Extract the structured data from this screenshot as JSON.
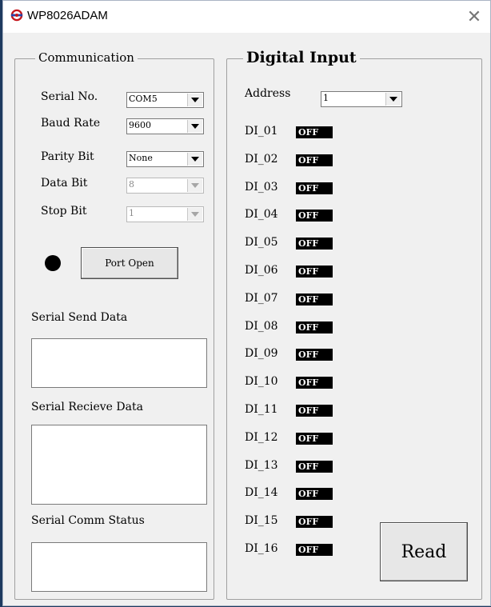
{
  "window": {
    "title": "WP8026ADAM",
    "close_glyph": "✕"
  },
  "communication": {
    "legend": "Communication",
    "serial_no": {
      "label": "Serial No.",
      "value": "COM5"
    },
    "baud_rate": {
      "label": "Baud Rate",
      "value": "9600"
    },
    "parity_bit": {
      "label": "Parity Bit",
      "value": "None"
    },
    "data_bit": {
      "label": "Data Bit",
      "value": "8"
    },
    "stop_bit": {
      "label": "Stop Bit",
      "value": "1"
    },
    "port_button": "Port Open",
    "led_color": "#000000",
    "send_label": "Serial Send Data",
    "send_value": "",
    "recv_label": "Serial Recieve Data",
    "recv_value": "",
    "status_label": "Serial Comm Status",
    "status_value": ""
  },
  "digital_input": {
    "legend": "Digital Input",
    "address_label": "Address",
    "address_value": "1",
    "channels": [
      {
        "label": "DI_01",
        "state": "OFF"
      },
      {
        "label": "DI_02",
        "state": "OFF"
      },
      {
        "label": "DI_03",
        "state": "OFF"
      },
      {
        "label": "DI_04",
        "state": "OFF"
      },
      {
        "label": "DI_05",
        "state": "OFF"
      },
      {
        "label": "DI_06",
        "state": "OFF"
      },
      {
        "label": "DI_07",
        "state": "OFF"
      },
      {
        "label": "DI_08",
        "state": "OFF"
      },
      {
        "label": "DI_09",
        "state": "OFF"
      },
      {
        "label": "DI_10",
        "state": "OFF"
      },
      {
        "label": "DI_11",
        "state": "OFF"
      },
      {
        "label": "DI_12",
        "state": "OFF"
      },
      {
        "label": "DI_13",
        "state": "OFF"
      },
      {
        "label": "DI_14",
        "state": "OFF"
      },
      {
        "label": "DI_15",
        "state": "OFF"
      },
      {
        "label": "DI_16",
        "state": "OFF"
      }
    ],
    "read_button": "Read"
  },
  "colors": {
    "off_bg": "#000000",
    "off_fg": "#ffffff",
    "window_bg": "#f0f0f0"
  },
  "icons": {
    "app": "app-logo-icon",
    "close": "close-icon",
    "dropdown": "chevron-down-icon"
  }
}
